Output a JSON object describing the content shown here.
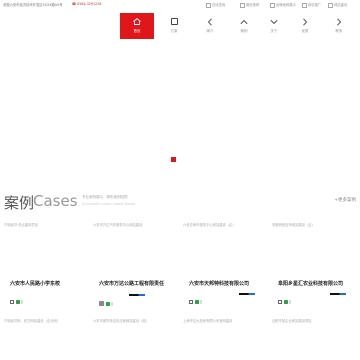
{
  "topbar": {
    "address": "安徽六安市经济技术开发区XXXX路XX号",
    "phone": "0564-3291228",
    "links": [
      "在线咨询",
      "微信推荐",
      "品牌案例展示",
      "网站推广",
      "网站建设"
    ]
  },
  "nav": {
    "items": [
      {
        "label": "首页",
        "icon": "home-icon"
      },
      {
        "label": "方案",
        "icon": "square-icon"
      },
      {
        "label": "简介",
        "icon": "chevron-left-icon"
      },
      {
        "label": "案例",
        "icon": "chevron-up-icon"
      },
      {
        "label": "关于",
        "icon": "chevron-down-icon"
      },
      {
        "label": "优势",
        "icon": "chevron-right-icon"
      },
      {
        "label": "联系",
        "icon": "chevron-right-icon"
      }
    ],
    "active_index": 0
  },
  "section": {
    "title_zh": "案例",
    "title_en": "Cases",
    "subtitle": "专业案例展示，精彩案例回顾",
    "subtitle_en": "Successful cases  Latest  Works",
    "more": "+更多案例"
  },
  "cases": [
    {
      "tag": "宁城经济·亮点建设项目",
      "name": "六安市人民路小学东校",
      "tag2": "宁城经济网，官方网站建设（企业网）"
    },
    {
      "tag": "六安市万达汽车服务中心网站建设",
      "name": "六安市万达公路工程有限责任",
      "tag2": "六安市城市综合执法局网站建设（政）"
    },
    {
      "tag": "六安亦养市服务中心网站建设（企）",
      "name": "六安市天邦特科技有限公司",
      "tag2": "上海市交大投资有限公司官网建设"
    },
    {
      "tag": "安徽皖西百商网站建设（企）",
      "name": "阜阳乡星汇农业科技有限公司",
      "tag2": "合肥市某企业网站建设项目"
    }
  ],
  "colors": {
    "accent": "#e0161b",
    "bar_blue": "#1e6fd9"
  }
}
